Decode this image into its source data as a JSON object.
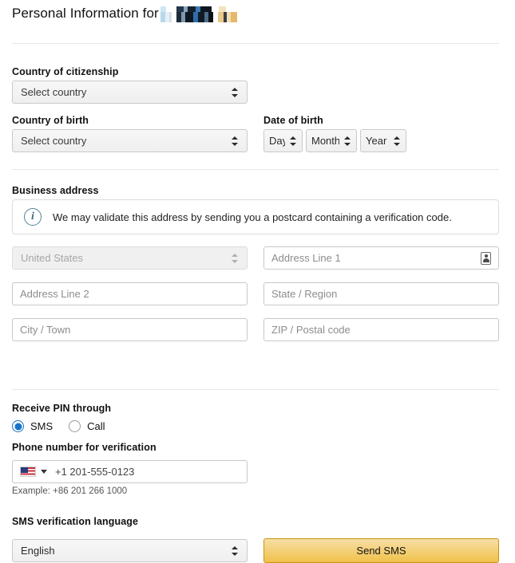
{
  "header": {
    "title": "Personal Information for",
    "redacted_name": "",
    "redaction_icon": "redacted-name-block"
  },
  "citizenship": {
    "label": "Country of citizenship",
    "select_value": "Select country"
  },
  "birth": {
    "label": "Country of birth",
    "select_value": "Select country"
  },
  "dob": {
    "label": "Date of birth",
    "day_value": "Day",
    "month_value": "Month",
    "year_value": "Year"
  },
  "business_address": {
    "label": "Business address",
    "info_text": "We may validate this address by sending you a postcard containing a verification code.",
    "info_icon": "info-circle-icon",
    "country_value": "United States",
    "address1_placeholder": "Address Line 1",
    "address1_icon": "autofill-contact-icon",
    "address2_placeholder": "Address Line 2",
    "state_placeholder": "State / Region",
    "city_placeholder": "City / Town",
    "zip_placeholder": "ZIP / Postal code"
  },
  "pin": {
    "label": "Receive PIN through",
    "option_sms": "SMS",
    "option_call": "Call",
    "selected": "SMS"
  },
  "phone": {
    "label": "Phone number for verification",
    "flag_icon": "us-flag-icon",
    "caret_icon": "chevron-down-icon",
    "placeholder": "+1 201-555-0123",
    "example": "Example: +86 201 266 1000"
  },
  "language": {
    "label": "SMS verification language",
    "select_value": "English"
  },
  "actions": {
    "send_sms": "Send SMS"
  },
  "colors": {
    "accent_blue": "#1874c8",
    "button_gold_top": "#f7dfa5",
    "button_gold_bottom": "#f0c14b",
    "button_border": "#c89411",
    "info_icon": "#4f8396"
  }
}
